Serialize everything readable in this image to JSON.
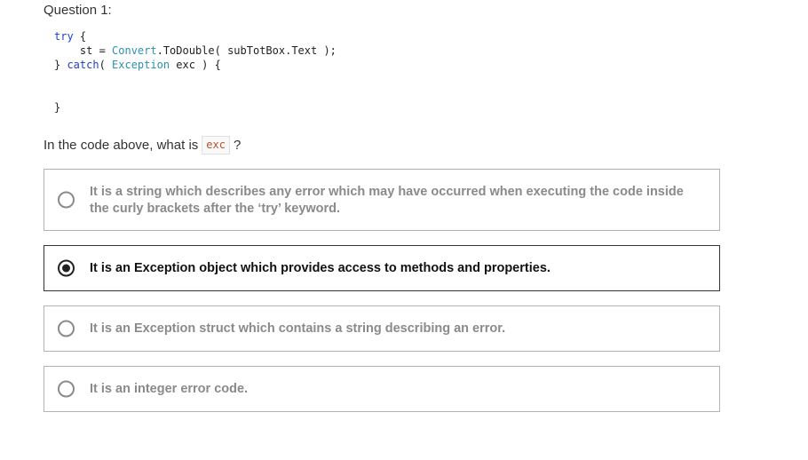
{
  "question": {
    "title": "Question 1:",
    "code": {
      "l1_kw": "try",
      "l1_rest": " {",
      "l2_a": "    st = ",
      "l2_type": "Convert",
      "l2_b": ".ToDouble( subTotBox.Text );",
      "l3_a": "} ",
      "l3_kw": "catch",
      "l3_b": "( ",
      "l3_type": "Exception",
      "l3_c": " exc ) {",
      "l4": "",
      "l5": "",
      "l6": "}"
    },
    "prompt_before": "In the code above, what is",
    "prompt_code": "exc",
    "prompt_after": "?"
  },
  "options": [
    {
      "text": "It is a string which describes any error which may have occurred when executing the code inside the curly brackets after the ‘try’ keyword.",
      "selected": false
    },
    {
      "text": "It is an Exception object which provides access to methods and properties.",
      "selected": true
    },
    {
      "text": "It is an Exception struct which contains a string describing an error.",
      "selected": false
    },
    {
      "text": "It is an integer error code.",
      "selected": false
    }
  ]
}
